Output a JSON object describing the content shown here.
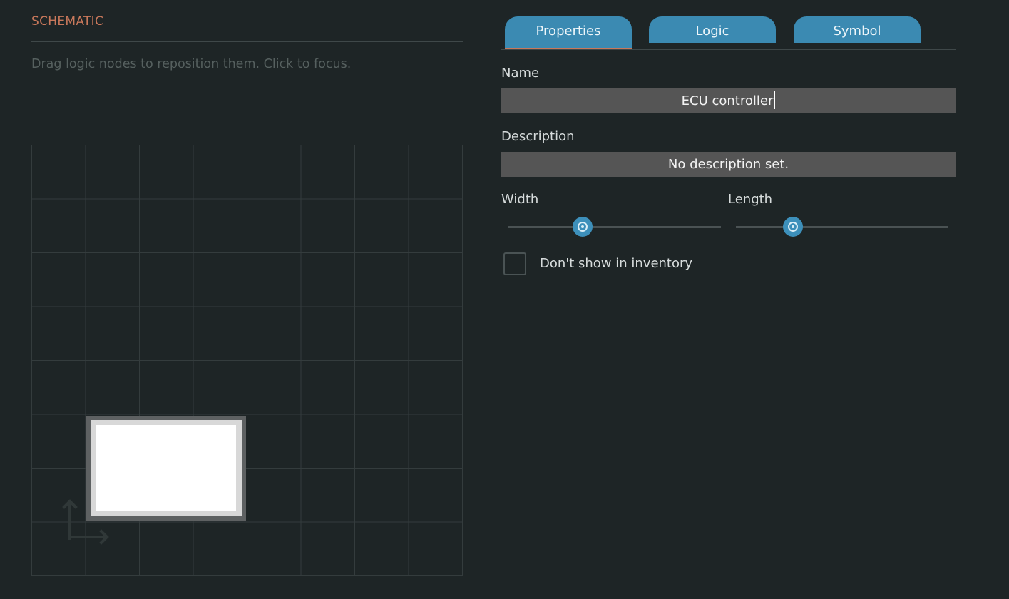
{
  "schematic": {
    "title": "SCHEMATIC",
    "hint": "Drag logic nodes to reposition them. Click to focus."
  },
  "tabs": [
    {
      "label": "Properties",
      "active": true
    },
    {
      "label": "Logic",
      "active": false
    },
    {
      "label": "Symbol",
      "active": false
    }
  ],
  "form": {
    "name_label": "Name",
    "name_value": "ECU controller",
    "description_label": "Description",
    "description_value": "No description set.",
    "width_label": "Width",
    "width_value_fraction": 0.35,
    "length_label": "Length",
    "length_value_fraction": 0.27,
    "inventory_checkbox_label": "Don't show in inventory",
    "inventory_checkbox_checked": false
  },
  "icons": {
    "axis": "axis-arrows-icon",
    "slider_knob": "target-ring-icon"
  },
  "colors": {
    "background": "#1e2526",
    "accent": "#3b8ab2",
    "title": "#c9785b",
    "field": "#555555"
  }
}
